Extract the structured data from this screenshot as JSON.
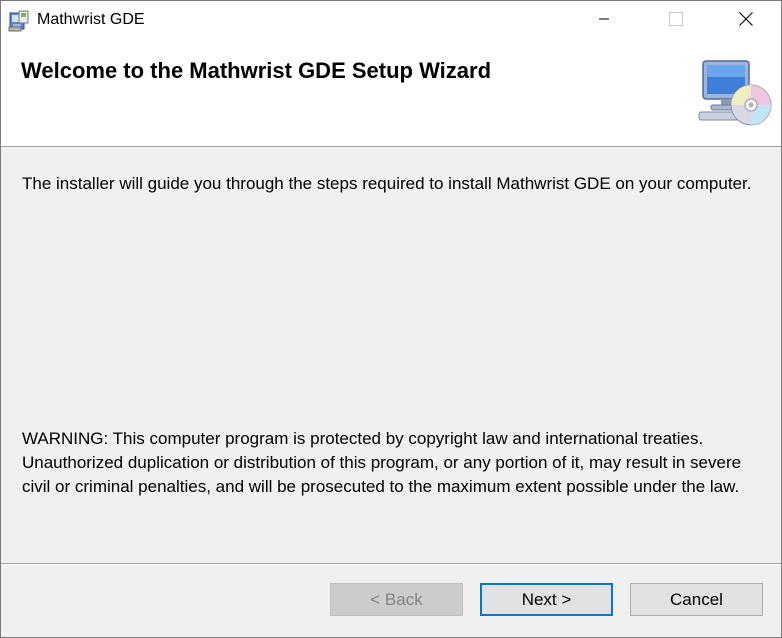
{
  "window": {
    "title": "Mathwrist GDE",
    "icons": {
      "app": "installer-app-icon",
      "minimize": "minimize-icon",
      "maximize": "maximize-icon",
      "close": "close-icon"
    }
  },
  "banner": {
    "title": "Welcome to the Mathwrist GDE Setup Wizard",
    "icon": "computer-cd-icon"
  },
  "content": {
    "intro": "The installer will guide you through the steps required to install Mathwrist GDE on your computer.",
    "warning": "WARNING: This computer program is protected by copyright law and international treaties. Unauthorized duplication or distribution of this program, or any portion of it, may result in severe civil or criminal penalties, and will be prosecuted to the maximum extent possible under the law."
  },
  "buttons": {
    "back": "< Back",
    "next": "Next >",
    "cancel": "Cancel"
  },
  "colors": {
    "focus_border": "#0078d7",
    "dialog_background": "#f0f0f0",
    "banner_background": "#ffffff",
    "disabled_text": "#838383"
  }
}
